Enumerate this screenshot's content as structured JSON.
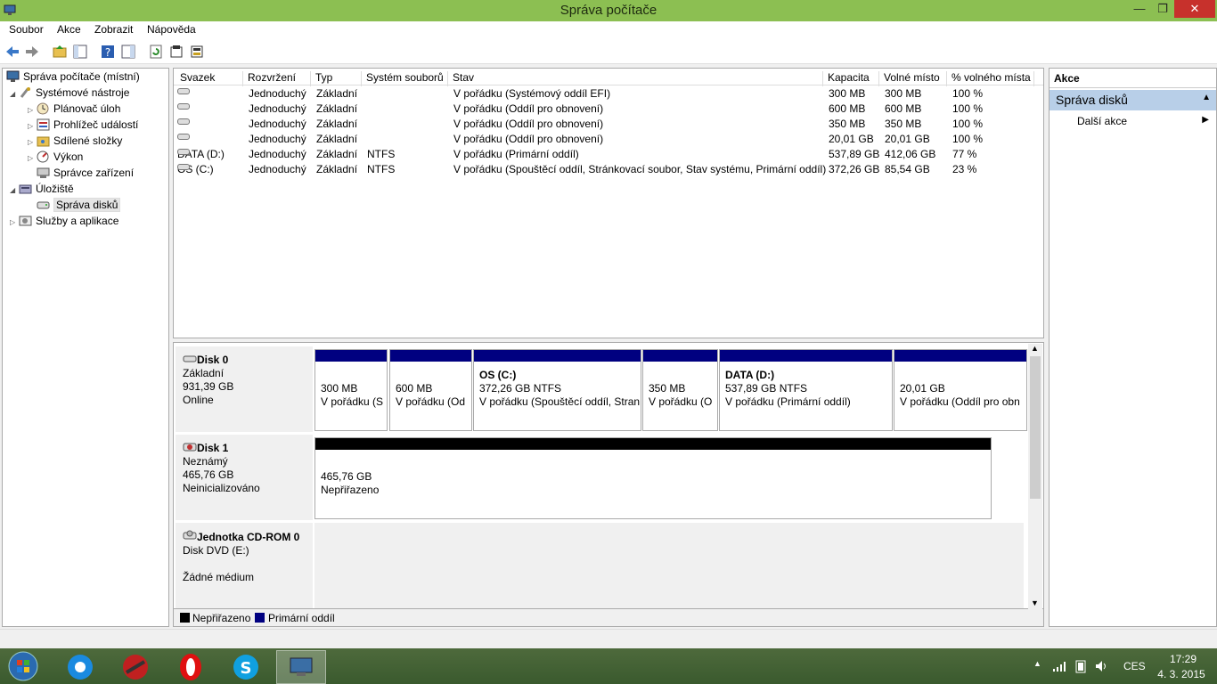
{
  "window": {
    "title": "Správa počítače",
    "min": "—",
    "max": "❐",
    "close": "✕"
  },
  "menu": [
    "Soubor",
    "Akce",
    "Zobrazit",
    "Nápověda"
  ],
  "tree": [
    {
      "label": "Správa počítače (místní)"
    },
    {
      "label": "Systémové nástroje"
    },
    {
      "label": "Plánovač úloh"
    },
    {
      "label": "Prohlížeč událostí"
    },
    {
      "label": "Sdílené složky"
    },
    {
      "label": "Výkon"
    },
    {
      "label": "Správce zařízení"
    },
    {
      "label": "Úložiště"
    },
    {
      "label": "Správa disků"
    },
    {
      "label": "Služby a aplikace"
    }
  ],
  "columns": [
    "Svazek",
    "Rozvržení",
    "Typ",
    "Systém souborů",
    "Stav",
    "Kapacita",
    "Volné místo",
    "% volného místa"
  ],
  "volumes": [
    {
      "name": "",
      "layout": "Jednoduchý",
      "type": "Základní",
      "fs": "",
      "status": "V pořádku (Systémový oddíl EFI)",
      "capacity": "300 MB",
      "free": "300 MB",
      "pct": "100 %"
    },
    {
      "name": "",
      "layout": "Jednoduchý",
      "type": "Základní",
      "fs": "",
      "status": "V pořádku (Oddíl pro obnovení)",
      "capacity": "600 MB",
      "free": "600 MB",
      "pct": "100 %"
    },
    {
      "name": "",
      "layout": "Jednoduchý",
      "type": "Základní",
      "fs": "",
      "status": "V pořádku (Oddíl pro obnovení)",
      "capacity": "350 MB",
      "free": "350 MB",
      "pct": "100 %"
    },
    {
      "name": "",
      "layout": "Jednoduchý",
      "type": "Základní",
      "fs": "",
      "status": "V pořádku (Oddíl pro obnovení)",
      "capacity": "20,01 GB",
      "free": "20,01 GB",
      "pct": "100 %"
    },
    {
      "name": "DATA (D:)",
      "layout": "Jednoduchý",
      "type": "Základní",
      "fs": "NTFS",
      "status": "V pořádku (Primární oddíl)",
      "capacity": "537,89 GB",
      "free": "412,06 GB",
      "pct": "77 %"
    },
    {
      "name": "OS (C:)",
      "layout": "Jednoduchý",
      "type": "Základní",
      "fs": "NTFS",
      "status": "V pořádku (Spouštěcí oddíl, Stránkovací soubor, Stav systému, Primární oddíl)",
      "capacity": "372,26 GB",
      "free": "85,54 GB",
      "pct": "23 %"
    }
  ],
  "disk0": {
    "name": "Disk 0",
    "type": "Základní",
    "size": "931,39 GB",
    "state": "Online",
    "parts": [
      {
        "title": "",
        "l1": "300 MB",
        "l2": "V pořádku (S"
      },
      {
        "title": "",
        "l1": "600 MB",
        "l2": "V pořádku (Od"
      },
      {
        "title": "OS  (C:)",
        "l1": "372,26 GB NTFS",
        "l2": "V pořádku (Spouštěcí oddíl, Stran"
      },
      {
        "title": "",
        "l1": "350 MB",
        "l2": "V pořádku (O"
      },
      {
        "title": "DATA  (D:)",
        "l1": "537,89 GB NTFS",
        "l2": "V pořádku (Primární oddíl)"
      },
      {
        "title": "",
        "l1": "20,01 GB",
        "l2": "V pořádku (Oddíl pro obn"
      }
    ]
  },
  "disk1": {
    "name": "Disk 1",
    "type": "Neznámý",
    "size": "465,76 GB",
    "state": "Neinicializováno",
    "part_l1": "465,76 GB",
    "part_l2": "Nepřiřazeno"
  },
  "cdrom": {
    "name": "Jednotka CD-ROM 0",
    "type": "Disk DVD (E:)",
    "state": "Žádné médium"
  },
  "legend": [
    {
      "label": "Nepřiřazeno",
      "color": "#000000"
    },
    {
      "label": "Primární oddíl",
      "color": "#000080"
    }
  ],
  "actions": {
    "header": "Akce",
    "section": "Správa disků",
    "item": "Další akce"
  },
  "tray": {
    "lang": "CES",
    "time": "17:29",
    "date": "4. 3. 2015"
  }
}
